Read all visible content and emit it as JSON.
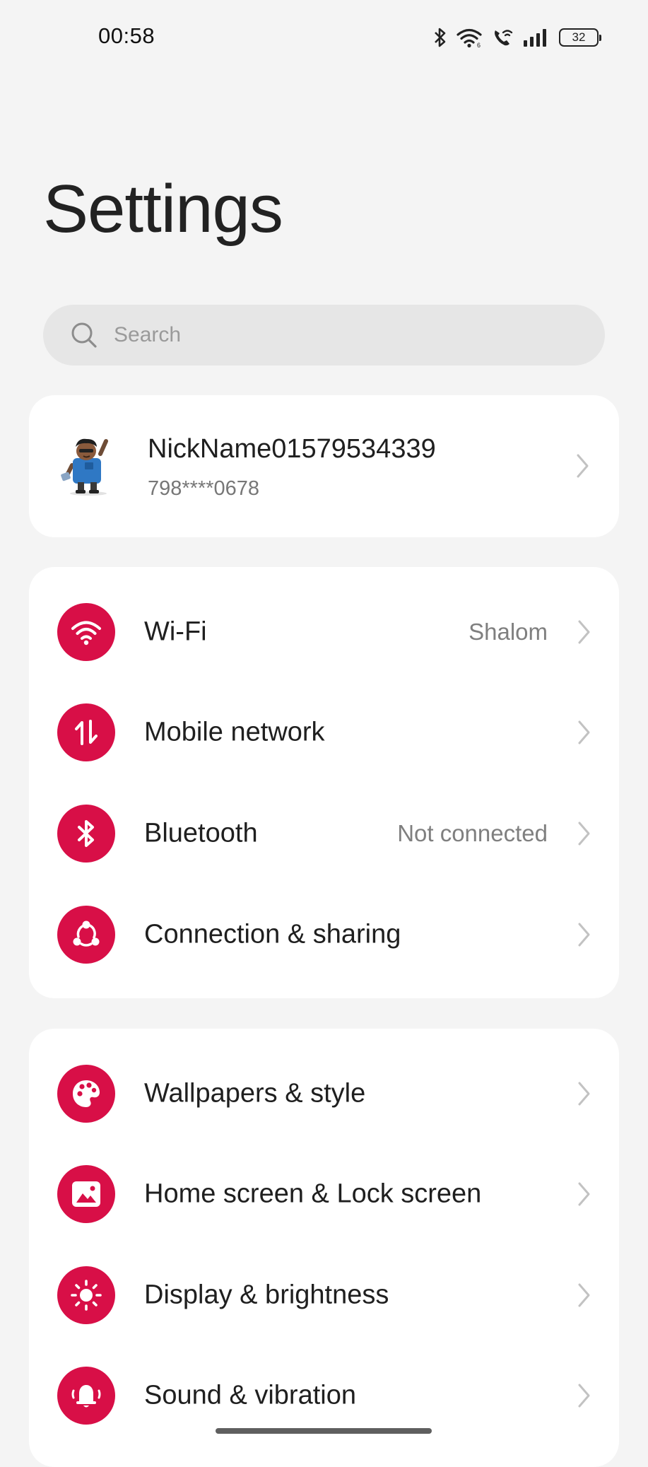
{
  "status_bar": {
    "time": "00:58",
    "battery_level": "32",
    "icons": [
      "bluetooth-icon",
      "wifi-icon",
      "wifi-calling-icon",
      "signal-icon",
      "battery-icon"
    ]
  },
  "page": {
    "title": "Settings"
  },
  "search": {
    "placeholder": "Search"
  },
  "account": {
    "name": "NickName01579534339",
    "phone": "798****0678"
  },
  "colors": {
    "accent": "#d80f47",
    "background": "#f4f4f4",
    "card": "#ffffff"
  },
  "connectivity_group": [
    {
      "label": "Wi-Fi",
      "value": "Shalom",
      "icon": "wifi-icon"
    },
    {
      "label": "Mobile network",
      "value": "",
      "icon": "mobile-data-icon"
    },
    {
      "label": "Bluetooth",
      "value": "Not connected",
      "icon": "bluetooth-icon"
    },
    {
      "label": "Connection & sharing",
      "value": "",
      "icon": "share-icon"
    }
  ],
  "personalization_group": [
    {
      "label": "Wallpapers & style",
      "icon": "palette-icon"
    },
    {
      "label": "Home screen & Lock screen",
      "icon": "image-icon"
    },
    {
      "label": "Display & brightness",
      "icon": "brightness-icon"
    },
    {
      "label": "Sound & vibration",
      "icon": "bell-icon"
    }
  ]
}
